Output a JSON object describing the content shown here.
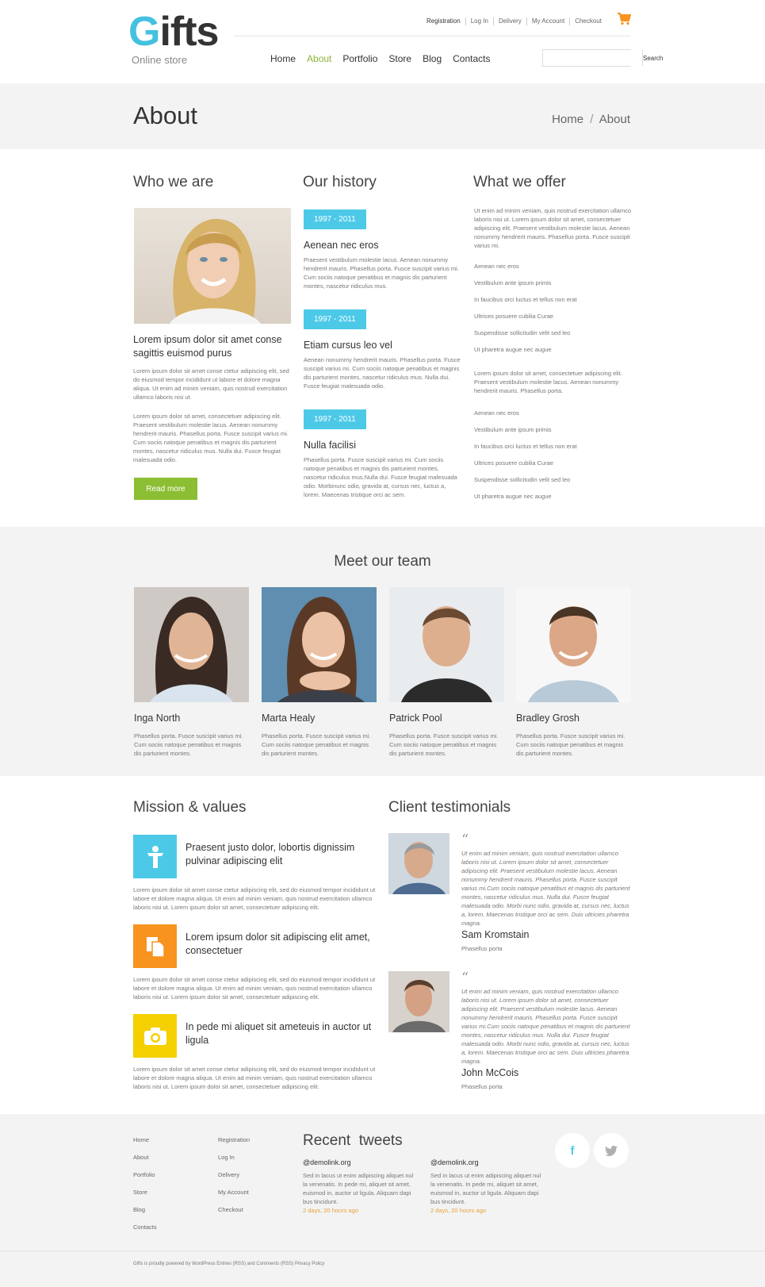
{
  "brand": {
    "logo_letter": "G",
    "logo_rest": "ifts",
    "tagline": "Online store"
  },
  "top_links": [
    "Registration",
    "Log In",
    "Delivery",
    "My Account",
    "Checkout"
  ],
  "nav": {
    "items": [
      "Home",
      "About",
      "Portfolio",
      "Store",
      "Blog",
      "Contacts"
    ],
    "active": "About"
  },
  "search": {
    "placeholder": "",
    "button": "Search"
  },
  "page": {
    "title": "About",
    "breadcrumb_home": "Home",
    "breadcrumb_sep": "/",
    "breadcrumb_current": "About"
  },
  "who": {
    "heading": "Who we are",
    "subheading": "Lorem ipsum dolor sit amet conse sagittis euismod purus",
    "p1": "Lorem ipsum dolor sit amet conse ctetur adipiscing elit, sed do eiusmod tempor incididunt ut labore et dolore magna aliqua. Ut enim ad minim veniam, quis nostrud exercitation ullamco laboris nisi ut.",
    "p2": "Lorem ipsum dolor sit amet, consectetuer adipiscing elit. Praesent vestibulum molestie lacus. Aenean nonummy hendrerit mauris. Phasellus porta. Fusce suscipit varius mi. Cum sociis natoque penatibus et magnis dis parturient montes, nascetur ridiculus mus. Nulla dui. Fusce feugiat malesuada odio.",
    "button": "Read more"
  },
  "history": {
    "heading": "Our history",
    "items": [
      {
        "period": "1997 - 2011",
        "title": "Aenean nec eros",
        "text": "Praesent vestibulum molestie lacus. Aenean nonummy hendrerit mauris. Phasellus porta. Fusce suscipit varius mi. Cum sociis natoque penatibus et magnis dis parturient montes, nascetur ridiculus mus."
      },
      {
        "period": "1997 - 2011",
        "title": "Etiam cursus leo vel",
        "text": "Aenean nonummy hendrerit mauris. Phasellus porta. Fusce suscipit varius mi. Cum sociis natoque penatibus et magnis dis parturient montes, nascetur ridiculus mus. Nulla dui. Fusce feugiat malesuada odio."
      },
      {
        "period": "1997 - 2011",
        "title": "Nulla facilisi",
        "text": "Phasellus porta. Fusce suscipit varius mi. Cum sociis natoque penatibus et magnis dis parturient montes, nascetur ridiculus mus.Nulla dui. Fusce feugiat malesuada odio. Morbinunc odio, gravida at, cursus nec, luctus a, lorem. Maecenas tristique orci ac sem."
      }
    ]
  },
  "offer": {
    "heading": "What we offer",
    "intro": "Ut enim ad minim veniam, quis nostrud exercitation ullamco laboris nisi ut. Lorem ipsum dolor sit amet, consectetuer adipiscing elit. Praesent vestibulum molestie lacus. Aenean nonummy hendrerit mauris. Phasellus porta. Fusce suscipit varius mi.",
    "list1": [
      "Aenean nec eros",
      "Vestibulum ante ipsum primis",
      "In faucibus orci luctus et  tellus non erat",
      "Ultrices posuere cubilia Curae",
      "Suspendisse sollicitudin velit sed leo",
      "Ut pharetra augue nec augue"
    ],
    "middle": "Lorem ipsum dolor sit amet, consectetuer adipiscing elit. Praesent vestibulum molestie lacus. Aenean nonummy hendrerit mauris. Phasellus porta.",
    "list2": [
      "Aenean nec eros",
      "Vestibulum ante ipsum primis",
      "In faucibus orci luctus et  tellus non erat",
      "Ultrices posuere cubilia Curae",
      "Suspendisse sollicitudin velit sed leo",
      "Ut pharetra augue nec augue"
    ]
  },
  "team": {
    "heading": "Meet our team",
    "members": [
      {
        "name": "Inga North",
        "text": "Phasellus porta. Fusce suscipit varius mi. Cum sociis natoque penatibus et magnis dis parturient montes."
      },
      {
        "name": "Marta Healy",
        "text": "Phasellus porta. Fusce suscipit varius mi. Cum sociis natoque penatibus et magnis dis parturient montes."
      },
      {
        "name": "Patrick Pool",
        "text": "Phasellus porta. Fusce suscipit varius mi. Cum sociis natoque penatibus et magnis dis parturient montes."
      },
      {
        "name": "Bradley Grosh",
        "text": "Phasellus porta. Fusce suscipit varius mi. Cum sociis natoque penatibus et magnis dis parturient montes."
      }
    ]
  },
  "mission": {
    "heading": "Mission & values",
    "items": [
      {
        "icon": "person-icon",
        "color": "#4dc9e8",
        "title": "Praesent justo dolor, lobortis dignissim pulvinar adipiscing elit",
        "text": "Lorem ipsum dolor sit amet conse ctetur adipiscing elit, sed do eiusmod tempor incididunt ut labore et dolore magna aliqua. Ut enim ad minim veniam, quis nostrud exercitation ullamco laboris nisi ut. Lorem ipsum dolor sit amet, consectetuer adipiscing elit."
      },
      {
        "icon": "document-icon",
        "color": "#f7931e",
        "title": "Lorem ipsum dolor sit  adipiscing elit amet, consectetuer",
        "text": "Lorem ipsum dolor sit amet conse ctetur adipiscing elit, sed do eiusmod tempor incididunt ut labore et dolore magna aliqua. Ut enim ad minim veniam, quis nostrud exercitation ullamco laboris nisi ut. Lorem ipsum dolor sit amet, consectetuer adipiscing elit."
      },
      {
        "icon": "camera-icon",
        "color": "#f5d000",
        "title": "In pede mi aliquet sit ameteuis in auctor ut ligula",
        "text": "Lorem ipsum dolor sit amet conse ctetur adipiscing elit, sed do eiusmod tempor incididunt ut labore et dolore magna aliqua. Ut enim ad minim veniam, quis nostrud exercitation ullamco laboris nisi ut. Lorem ipsum dolor sit amet, consectetuer adipiscing elit."
      }
    ]
  },
  "testimonials": {
    "heading": "Client testimonials",
    "quote_mark": "“",
    "items": [
      {
        "text": "Ut enim ad minim veniam, quis nostrud exercitation ullamco laboris nisi ut. Lorem ipsum dolor sit amet, consectetuer adipiscing elit. Praesent vestibulum molestie lacus. Aenean nonummy hendrerit mauris. Phasellus porta. Fusce suscipit varius mi.Cum sociis natoque penatibus et magnis dis parturient montes, nascetur ridiculus mus. Nulla dui. Fusce feugiat malesuada odio. Morbi nunc odio, gravida at, cursus nec, luctus a, lorem. Maecenas tristique orci ac sem. Duis ultricies pharetra magna.",
        "name": "Sam Kromstain",
        "role": "Phasellus porta"
      },
      {
        "text": "Ut enim ad minim veniam, quis nostrud exercitation ullamco laboris nisi ut. Lorem ipsum dolor sit amet, consectetuer adipiscing elit. Praesent vestibulum molestie lacus. Aenean nonummy hendrerit mauris. Phasellus porta. Fusce suscipit varius mi.Cum sociis natoque penatibus et magnis dis parturient montes, nascetur ridiculus mus. Nulla dui. Fusce feugiat malesuada odio. Morbi nunc odio, gravida at, cursus nec, luctus a, lorem. Maecenas tristique orci ac sem. Duis ultricies pharetra magna.",
        "name": "John McCois",
        "role": "Phasellus porta"
      }
    ]
  },
  "footer": {
    "col1": [
      "Home",
      "About",
      "Portfolio",
      "Store",
      "Blog",
      "Contacts"
    ],
    "col2": [
      "Registration",
      "Log In",
      "Delivery",
      "My Account",
      "Checkout"
    ],
    "tweets_heading": "Recent  tweets",
    "tweets": [
      {
        "handle": "@demolink.org",
        "text": "Sed in lacus ut enim adipiscing aliquet nul la venenatis. In pede mi, aliquet sit amet, euismod in, auctor ut ligula. Aliquam dapi bus tincidunt.",
        "time": "2 days, 20 hours ago"
      },
      {
        "handle": "@demolink.org",
        "text": "Sed in lacus ut enim adipiscing aliquet nul la venenatis. In pede mi, aliquet sit amet, euismod in, auctor ut ligula. Aliquam dapi bus tincidunt.",
        "time": "2 days, 20 hours ago"
      }
    ],
    "social": {
      "facebook": "f",
      "twitter": "twitter-icon"
    },
    "copyright": "Gifts is proudly powered by WordPress Entries (RSS) and Comments (RSS) Privacy Policy"
  },
  "colors": {
    "accent_green": "#8cbe33",
    "accent_blue": "#4dc9e8",
    "orange": "#f7931e",
    "yellow": "#f5d000",
    "band_gray": "#f3f3f3"
  }
}
